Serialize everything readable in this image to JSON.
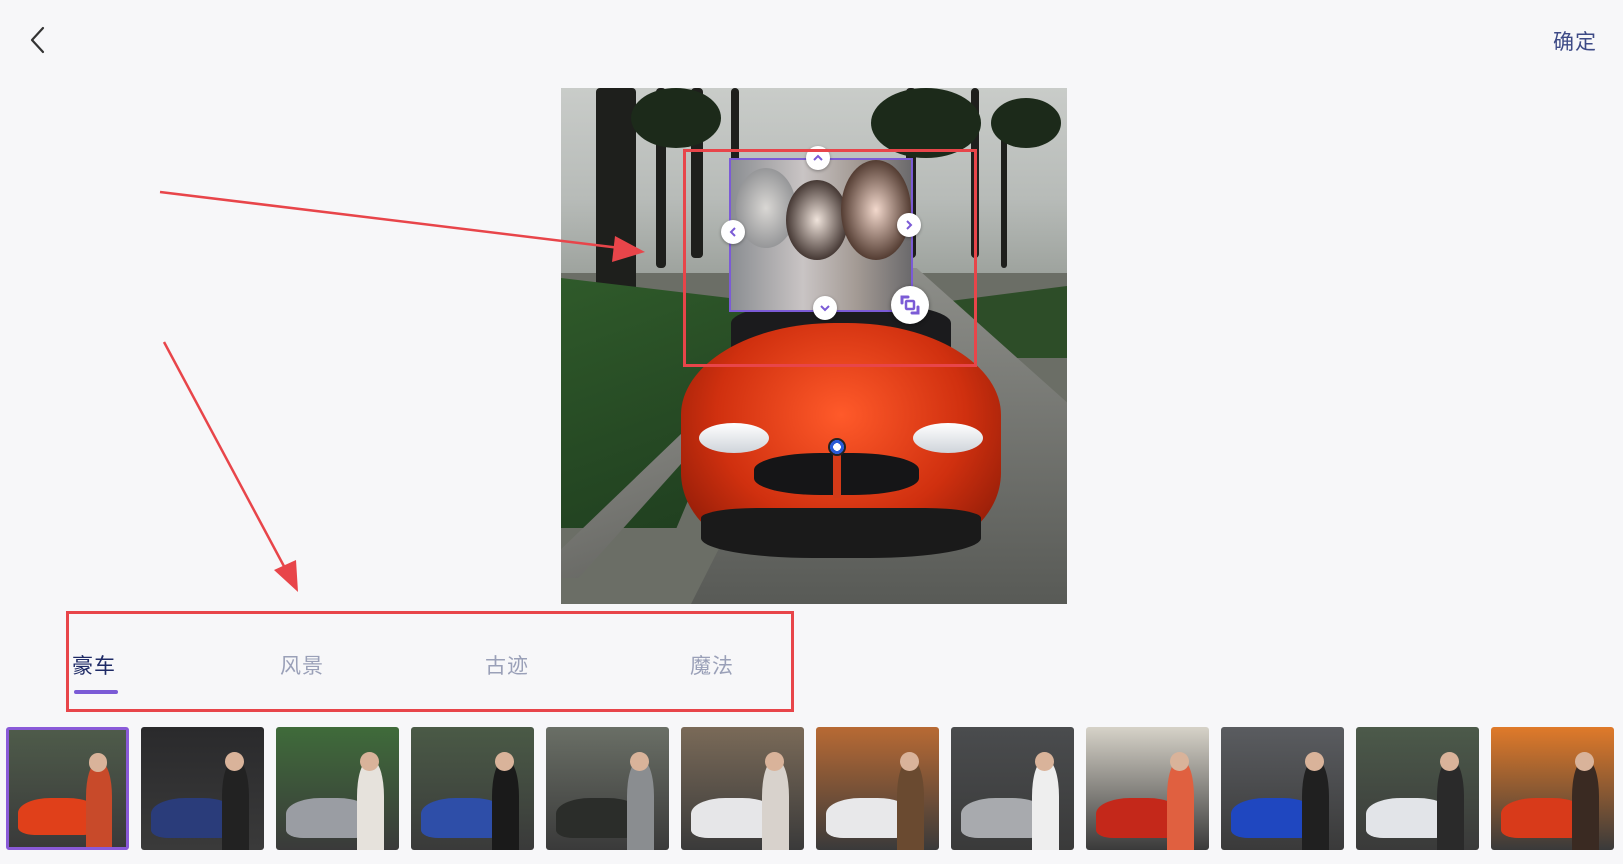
{
  "header": {
    "confirm_label": "确定"
  },
  "tabs": [
    {
      "label": "豪车",
      "active": true
    },
    {
      "label": "风景",
      "active": false
    },
    {
      "label": "古迹",
      "active": false
    },
    {
      "label": "魔法",
      "active": false
    }
  ],
  "colors": {
    "accent": "#7b5bd6",
    "annotation": "#e8454a",
    "confirm_text": "#3d4a86",
    "tab_active": "#1e2a66",
    "tab_inactive": "#9aa0b8"
  },
  "icons": {
    "back": "chevron-left-icon",
    "handle_top": "chevron-up-icon",
    "handle_left": "chevron-left-icon",
    "handle_right": "chevron-right-icon",
    "handle_bottom": "chevron-down-icon",
    "resize": "resize-icon"
  },
  "thumbnails": [
    {
      "bg": "#4e5b4a",
      "car": "#e0401a",
      "person": "#c84a2a",
      "selected": true
    },
    {
      "bg": "#2a2a2c",
      "car": "#2a3c7a",
      "person": "#222222",
      "selected": false
    },
    {
      "bg": "#3f6b3a",
      "car": "#9a9da3",
      "person": "#e6e2dc",
      "selected": false
    },
    {
      "bg": "#4a5a46",
      "car": "#2e4ea8",
      "person": "#1a1a1a",
      "selected": false
    },
    {
      "bg": "#6a6f66",
      "car": "#2b2d2a",
      "person": "#8a8d90",
      "selected": false
    },
    {
      "bg": "#7a6a58",
      "car": "#e6e6e8",
      "person": "#d8d2cc",
      "selected": false
    },
    {
      "bg": "#b86a34",
      "car": "#e8e8ea",
      "person": "#6a4a30",
      "selected": false
    },
    {
      "bg": "#4a4c4e",
      "car": "#a8aaae",
      "person": "#eeeeee",
      "selected": false
    },
    {
      "bg": "#d6d2c8",
      "car": "#c4281a",
      "person": "#e06040",
      "selected": false
    },
    {
      "bg": "#5a5c60",
      "car": "#1f47c0",
      "person": "#202020",
      "selected": false
    },
    {
      "bg": "#4c5a4a",
      "car": "#e2e4e8",
      "person": "#2a2a2a",
      "selected": false
    },
    {
      "bg": "#e07a2a",
      "car": "#d83a1a",
      "person": "#3a2a22",
      "selected": false
    }
  ]
}
